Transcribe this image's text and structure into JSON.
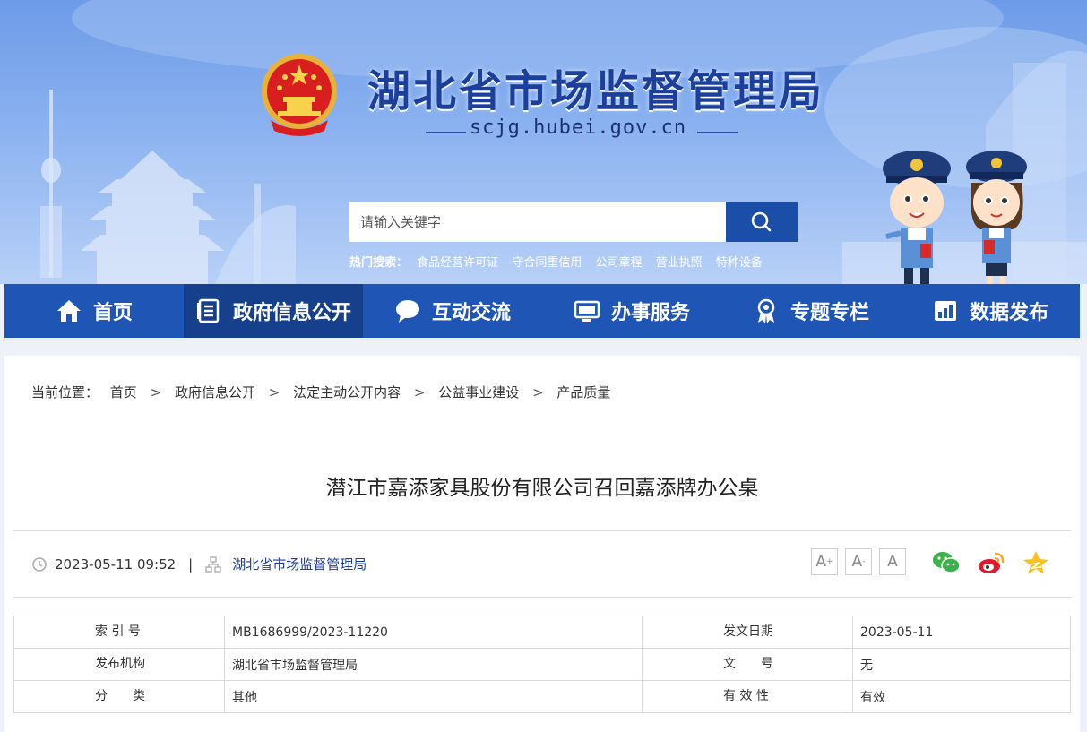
{
  "site": {
    "title": "湖北省市场监督管理局",
    "url": "scjg.hubei.gov.cn"
  },
  "search": {
    "placeholder": "请输入关键字",
    "button_icon": "search-icon",
    "hot_label": "热门搜索：",
    "hot_items": [
      "食品经营许可证",
      "守合同重信用",
      "公司章程",
      "营业执照",
      "特种设备"
    ]
  },
  "nav": {
    "items": [
      {
        "label": "首页",
        "icon": "home-icon"
      },
      {
        "label": "政府信息公开",
        "icon": "document-icon"
      },
      {
        "label": "互动交流",
        "icon": "chat-bubble-icon"
      },
      {
        "label": "办事服务",
        "icon": "monitor-icon"
      },
      {
        "label": "专题专栏",
        "icon": "award-icon"
      },
      {
        "label": "数据发布",
        "icon": "bar-chart-icon"
      }
    ],
    "active_index": 1
  },
  "breadcrumb": {
    "label": "当前位置：",
    "items": [
      "首页",
      "政府信息公开",
      "法定主动公开内容",
      "公益事业建设",
      "产品质量"
    ],
    "separator": ">"
  },
  "article": {
    "title": "潜江市嘉添家具股份有限公司召回嘉添牌办公桌",
    "datetime": "2023-05-11 09:52",
    "divider": "|",
    "publisher": "湖北省市场监督管理局"
  },
  "font_size": {
    "increase": "A",
    "increase_sup": "+",
    "decrease": "A",
    "decrease_sup": "-",
    "reset": "A"
  },
  "share": [
    "wechat-icon",
    "weibo-icon",
    "qzone-icon"
  ],
  "info_table": {
    "rows": [
      {
        "label1": "索 引 号",
        "value1": "MB1686999/2023-11220",
        "label2": "发文日期",
        "value2": "2023-05-11"
      },
      {
        "label1": "发布机构",
        "value1": "湖北省市场监督管理局",
        "label2": "文　　号",
        "value2": "无"
      },
      {
        "label1": "分　　类",
        "value1": "其他",
        "label2": "有 效 性",
        "value2": "有效"
      }
    ]
  },
  "colors": {
    "nav_bg": "#1f56b5",
    "nav_active": "#163f8c",
    "title_blue": "#1b3f9a",
    "search_button": "#1b4ea8"
  }
}
